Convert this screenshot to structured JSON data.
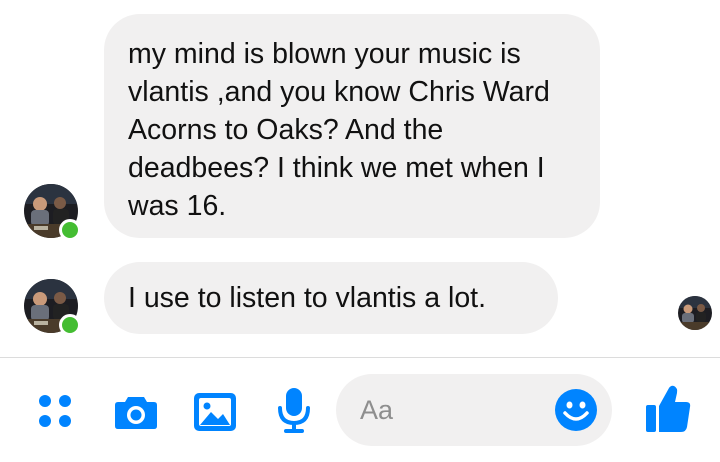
{
  "conversation": {
    "messages": [
      {
        "sender": "contact",
        "text": "my mind is blown your music is vlantis ,and you know Chris Ward Acorns to Oaks? And the deadbees? I think we met when I was 16."
      },
      {
        "sender": "contact",
        "text": "I use to listen to vlantis a lot."
      }
    ]
  },
  "composer": {
    "placeholder": "Aa"
  },
  "toolbar": {
    "icons": [
      "more-apps-icon",
      "camera-icon",
      "gallery-icon",
      "microphone-icon",
      "emoji-icon",
      "thumbs-up-icon"
    ]
  },
  "colors": {
    "accent": "#0084ff",
    "bubble_bg": "#f1f0f0",
    "online": "#44bd32",
    "divider": "#dcdcdc"
  }
}
